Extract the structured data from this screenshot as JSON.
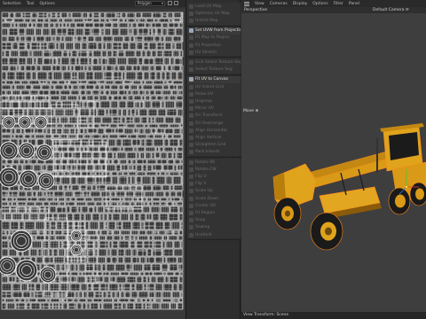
{
  "uv_editor": {
    "menu": [
      "Selection",
      "Tool",
      "Options"
    ],
    "mode_select": "Polygon"
  },
  "tools": {
    "section1": [
      {
        "label": "Load UV Map",
        "active": false
      },
      {
        "label": "Optimize UV Map",
        "active": false
      },
      {
        "label": "Unfold Map",
        "active": false
      }
    ],
    "section2": [
      {
        "label": "Set UVW from Projection",
        "active": true
      },
      {
        "label": "Fit Map to Region",
        "active": false
      },
      {
        "label": "Fit Projection",
        "active": false
      },
      {
        "label": "UV Stretch",
        "active": false
      }
    ],
    "section3": [
      {
        "label": "Grid Select Texture Seg",
        "active": false
      },
      {
        "label": "Select Texture Seg",
        "active": false
      }
    ],
    "section4": [
      {
        "label": "Fit UV to Canvas",
        "active": true
      },
      {
        "label": "UV Island Grid",
        "active": false
      },
      {
        "label": "Relax UV",
        "active": false
      },
      {
        "label": "Ungroup",
        "active": false
      },
      {
        "label": "Mirror UV",
        "active": false
      },
      {
        "label": "Ori Transform",
        "active": false
      },
      {
        "label": "Ori Rearrange",
        "active": false
      },
      {
        "label": "Align Horizontal",
        "active": false
      },
      {
        "label": "Align Vertical",
        "active": false
      },
      {
        "label": "Straighten Grid",
        "active": false
      },
      {
        "label": "Pack Islands",
        "active": false
      }
    ],
    "section5": [
      {
        "label": "Rotate 90",
        "active": false
      },
      {
        "label": "Rotate CW",
        "active": false
      },
      {
        "label": "Flip U",
        "active": false
      },
      {
        "label": "Flip V",
        "active": false
      },
      {
        "label": "Scale Up",
        "active": false
      },
      {
        "label": "Scale Down",
        "active": false
      },
      {
        "label": "Center UV",
        "active": false
      },
      {
        "label": "Fit Region",
        "active": false
      },
      {
        "label": "Snap",
        "active": false
      },
      {
        "label": "Sewing",
        "active": false
      },
      {
        "label": "Unstitch",
        "active": false
      }
    ]
  },
  "viewport": {
    "menu": [
      "View",
      "Cameras",
      "Display",
      "Options",
      "Filter",
      "Panel"
    ],
    "view_name": "Perspective",
    "camera_name": "Default Camera",
    "move_label": "Move",
    "status": "View Transform: Scene"
  },
  "colors": {
    "tractor_body": "#e0a31c",
    "tractor_shadow": "#8a5b0a",
    "tyre": "#1a1a1a",
    "selection_outline": "#ff8c1a",
    "uv_wire": "#ffffff"
  }
}
